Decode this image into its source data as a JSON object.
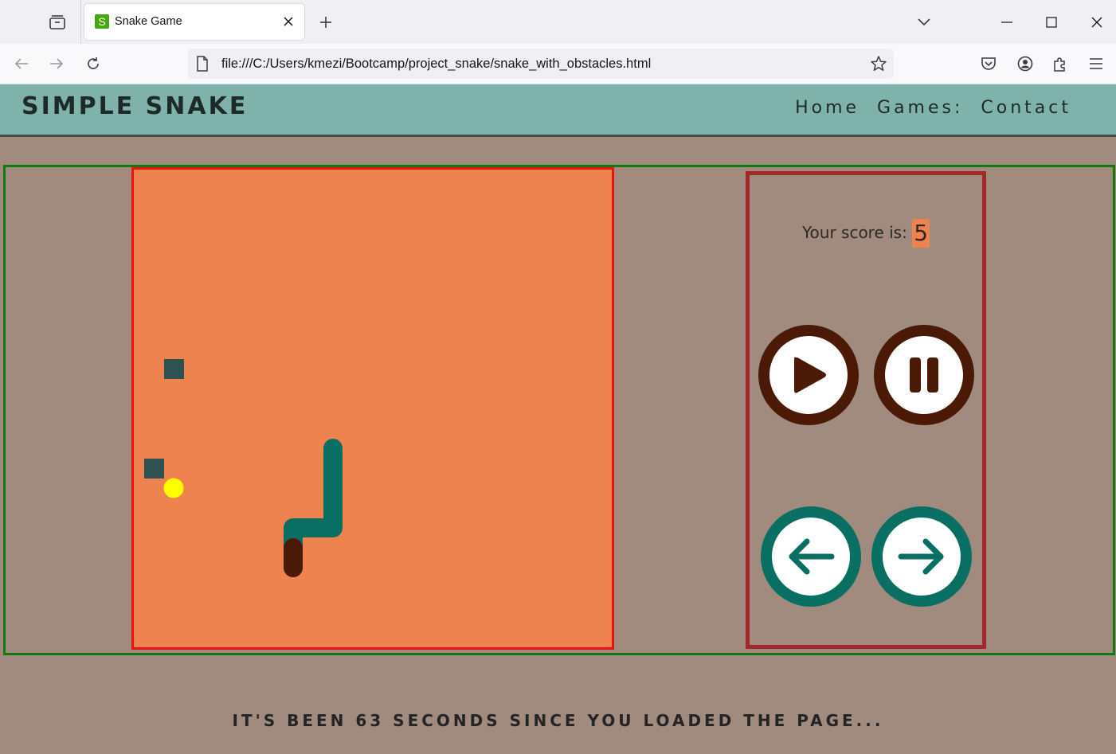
{
  "browser": {
    "tab_title": "Snake Game",
    "favicon_letter": "S",
    "url": "file:///C:/Users/kmezi/Bootcamp/project_snake/snake_with_obstacles.html"
  },
  "site": {
    "title": "SIMPLE SNAKE",
    "nav": [
      "Home",
      "Games:",
      "Contact"
    ]
  },
  "game": {
    "score_label": "Your score is:",
    "score": "5",
    "snake_color": "#0a6f63",
    "snake_tail_color": "#4a1a06",
    "food_color": "#ffff00",
    "obstacle_color": "#2e5251",
    "board_color": "#ef834f"
  },
  "controls": {
    "play": "play-icon",
    "pause": "pause-icon",
    "left": "arrow-left-icon",
    "right": "arrow-right-icon"
  },
  "footer": {
    "message": "IT'S BEEN 63 SECONDS SINCE YOU LOADED THE PAGE..."
  }
}
